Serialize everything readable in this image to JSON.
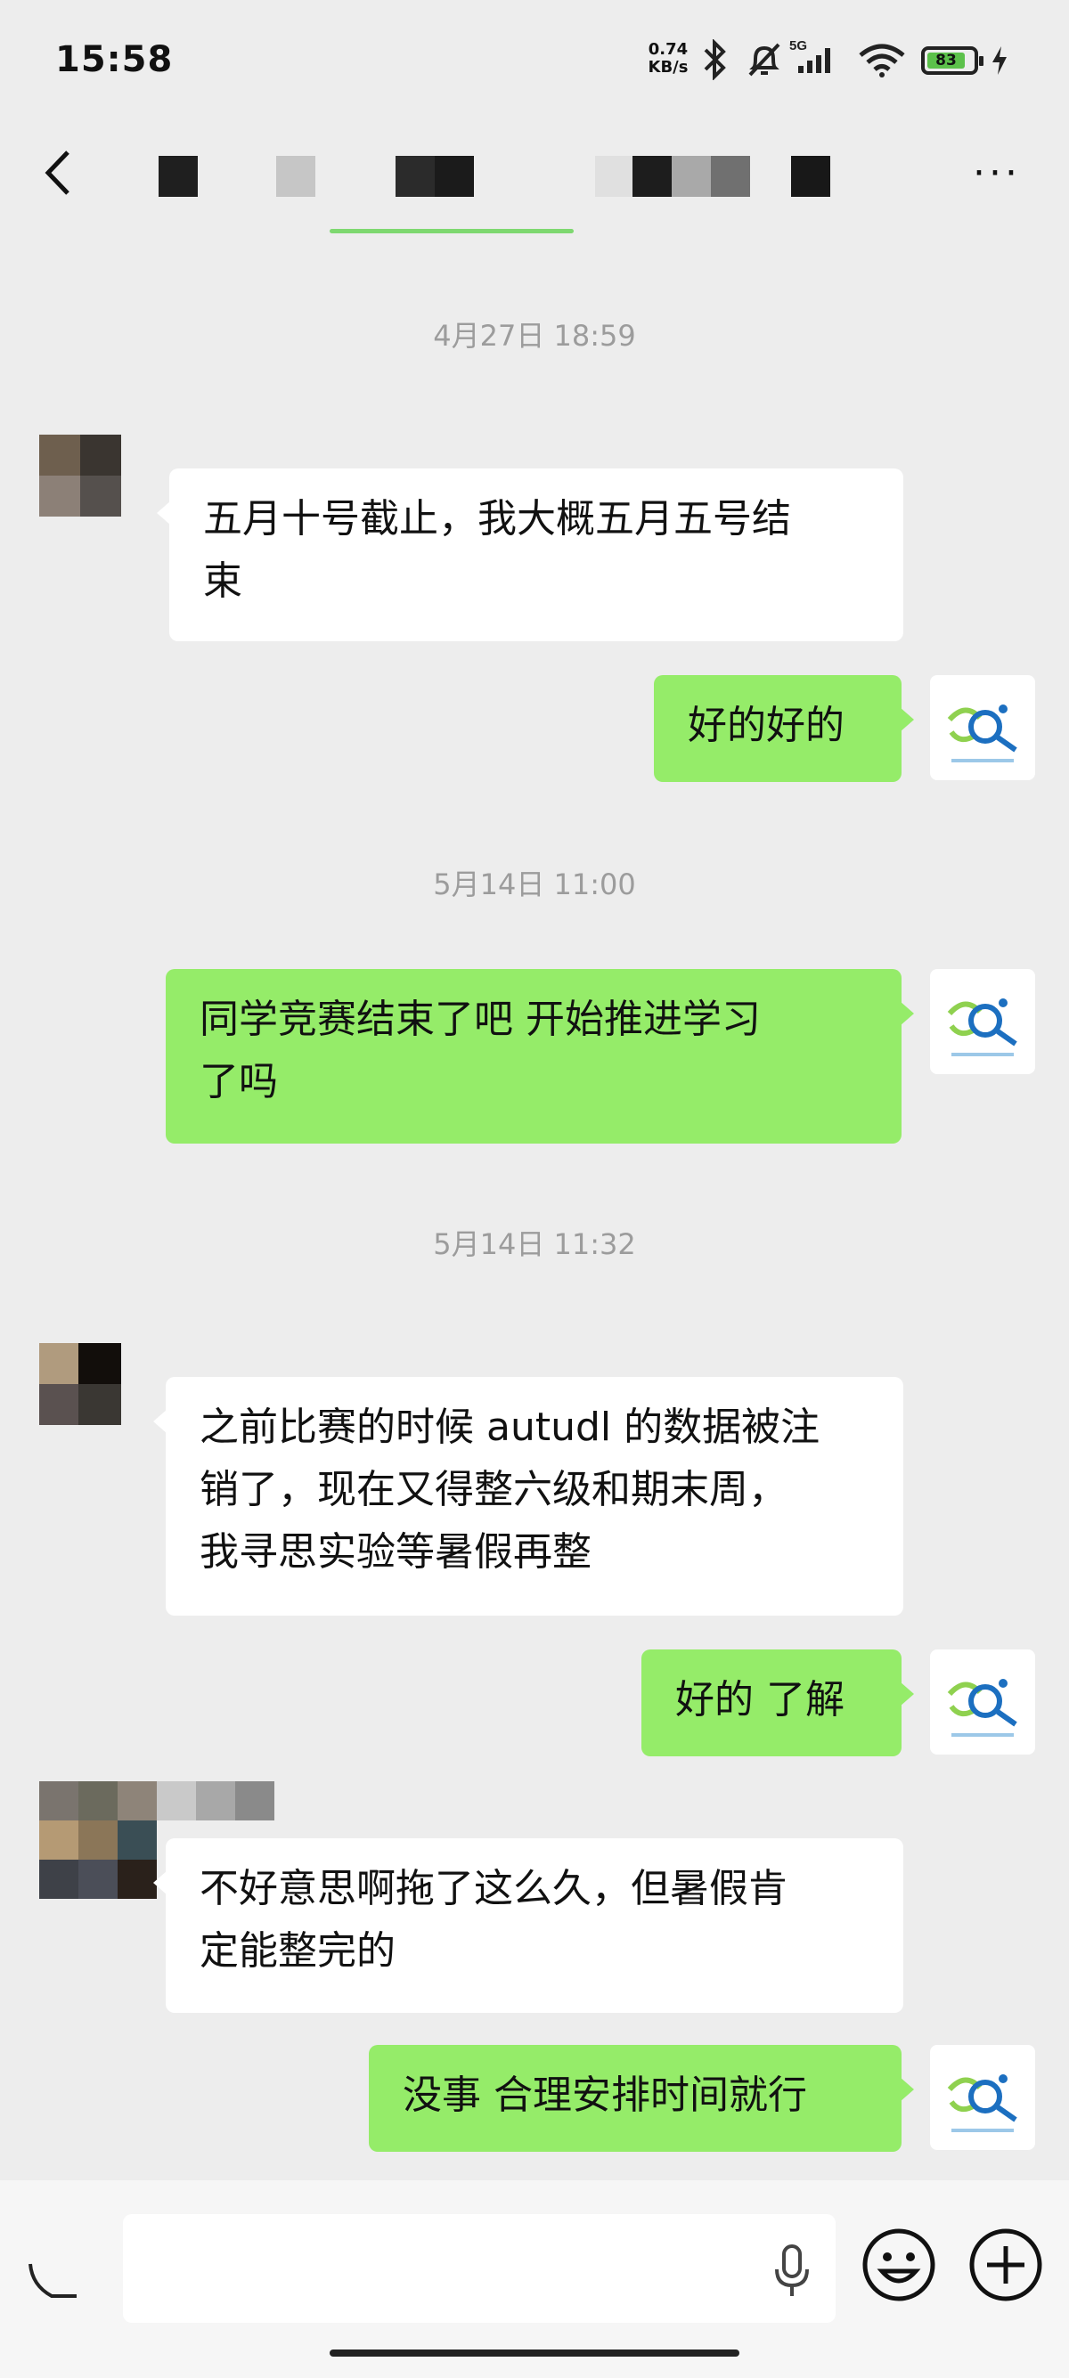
{
  "status_bar": {
    "time": "15:58",
    "net_speed_value": "0.74",
    "net_speed_unit": "KB/s",
    "network_type": "5G",
    "battery_level": "83",
    "icons": [
      "bluetooth-icon",
      "mute-bell-icon",
      "signal-icon",
      "wifi-icon",
      "battery-icon",
      "charging-icon"
    ]
  },
  "header": {
    "title_redacted": true,
    "more_label": "···"
  },
  "messages": [
    {
      "type": "timestamp",
      "text": "4月27日 18:59"
    },
    {
      "type": "in",
      "lines": [
        "五月十号截止，我大概五月五号结",
        "束"
      ]
    },
    {
      "type": "out",
      "lines": [
        "好的好的"
      ]
    },
    {
      "type": "timestamp",
      "text": "5月14日 11:00"
    },
    {
      "type": "out",
      "lines": [
        "同学竞赛结束了吧 开始推进学习",
        "了吗"
      ]
    },
    {
      "type": "timestamp",
      "text": "5月14日 11:32"
    },
    {
      "type": "in",
      "lines": [
        "之前比赛的时候 autudl 的数据被注",
        "销了，现在又得整六级和期末周，",
        "我寻思实验等暑假再整"
      ]
    },
    {
      "type": "out",
      "lines": [
        "好的 了解"
      ]
    },
    {
      "type": "in",
      "lines": [
        "不好意思啊拖了这么久，但暑假肯",
        "定能整完的"
      ]
    },
    {
      "type": "out",
      "lines": [
        "没事 合理安排时间就行"
      ]
    }
  ],
  "colors": {
    "background": "#ededed",
    "out_bubble": "#95ec69",
    "in_bubble": "#ffffff",
    "timestamp": "#9c9c9c",
    "accent_logo_green": "#8fd14f",
    "accent_logo_blue": "#1c6fc0"
  },
  "input_bar": {
    "placeholder": "",
    "icons": [
      "voice-icon",
      "microphone-icon",
      "emoji-icon",
      "plus-icon"
    ]
  }
}
